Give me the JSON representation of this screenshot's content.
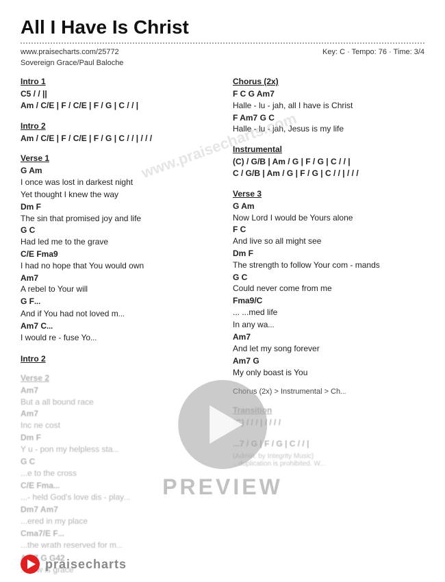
{
  "title": "All I Have Is Christ",
  "meta": {
    "url": "www.praisecharts.com/25772",
    "key_tempo_time": "Key: C · Tempo: 76 · Time: 3/4",
    "author": "Sovereign Grace/Paul Baloche"
  },
  "sections": {
    "left": [
      {
        "id": "intro1",
        "title": "Intro 1",
        "lines": [
          {
            "type": "chord",
            "text": "C5  /  /  ||"
          },
          {
            "type": "chord",
            "text": "Am  /  C/E  |  F  /  C/E  |  F  /  G  |  C  /  /  |"
          }
        ]
      },
      {
        "id": "intro2",
        "title": "Intro 2",
        "lines": [
          {
            "type": "chord",
            "text": "Am  /  C/E  |  F  /  C/E  |  F  /  G  |  C  /  /  |  /  /  /"
          }
        ]
      },
      {
        "id": "verse1",
        "title": "Verse 1",
        "lines": [
          {
            "type": "chord",
            "text": "             G             Am"
          },
          {
            "type": "lyric",
            "text": "I once was lost in darkest night"
          },
          {
            "type": "lyric",
            "text": "Yet thought I knew the way"
          },
          {
            "type": "chord",
            "text": "         Dm                       F"
          },
          {
            "type": "lyric",
            "text": "The sin that promised joy and life"
          },
          {
            "type": "chord",
            "text": "             G          C"
          },
          {
            "type": "lyric",
            "text": "Had led me to the grave"
          },
          {
            "type": "chord",
            "text": "      C/E                  Fma9"
          },
          {
            "type": "lyric",
            "text": "I had no hope that You would own"
          },
          {
            "type": "chord",
            "text": "              Am7"
          },
          {
            "type": "lyric",
            "text": "A rebel to Your will"
          },
          {
            "type": "chord",
            "text": "          G                     F..."
          },
          {
            "type": "lyric",
            "text": "And if You had not loved m..."
          },
          {
            "type": "chord",
            "text": "       Am7          C..."
          },
          {
            "type": "lyric",
            "text": "I would re - fuse Yo..."
          }
        ]
      },
      {
        "id": "intro2b",
        "title": "Intro 2",
        "lines": []
      },
      {
        "id": "verse2",
        "title": "Verse 2",
        "lines": [
          {
            "type": "chord",
            "text": "                        Am7"
          },
          {
            "type": "lyric",
            "text": "But a           all bound race"
          },
          {
            "type": "chord",
            "text": "                  Am7"
          },
          {
            "type": "lyric",
            "text": "Inc           ne cost"
          },
          {
            "type": "chord",
            "text": "              Dm             F"
          },
          {
            "type": "lyric",
            "text": "Y     u - pon my helpless sta..."
          },
          {
            "type": "chord",
            "text": "     G       C"
          },
          {
            "type": "lyric",
            "text": "...e to the cross"
          },
          {
            "type": "chord",
            "text": "      C/E                     Fma..."
          },
          {
            "type": "lyric",
            "text": "...- held God's love dis - play..."
          },
          {
            "type": "chord",
            "text": "         Dm7      Am7"
          },
          {
            "type": "lyric",
            "text": "...ered in  my place"
          },
          {
            "type": "chord",
            "text": "         Cma7/E              F..."
          },
          {
            "type": "lyric",
            "text": "...the wrath reserved for m..."
          },
          {
            "type": "chord",
            "text": "    Am7     G      G42"
          },
          {
            "type": "lyric",
            "text": "...now is grace"
          }
        ]
      }
    ],
    "right": [
      {
        "id": "chorus",
        "title": "Chorus (2x)",
        "lines": [
          {
            "type": "chord",
            "text": "          F    C         G      Am7"
          },
          {
            "type": "lyric",
            "text": "Halle - lu - jah, all I have is Christ"
          },
          {
            "type": "chord",
            "text": "             F      Am7        G          C"
          },
          {
            "type": "lyric",
            "text": "Halle - lu - jah, Jesus is my life"
          }
        ]
      },
      {
        "id": "instrumental",
        "title": "Instrumental",
        "lines": [
          {
            "type": "chord",
            "text": "(C)  /  G/B  |  Am  /  G  |  F  /  G  |  C  /  /  |"
          },
          {
            "type": "chord",
            "text": "C  /  G/B  |  Am  /  G  |  F  /  G  |  C  /  /  |  /  /  /"
          }
        ]
      },
      {
        "id": "verse3",
        "title": "Verse 3",
        "lines": [
          {
            "type": "chord",
            "text": "                G                 Am"
          },
          {
            "type": "lyric",
            "text": "Now Lord I would be Yours alone"
          },
          {
            "type": "chord",
            "text": "                   F              C"
          },
          {
            "type": "lyric",
            "text": "And live so all might see"
          },
          {
            "type": "chord",
            "text": "               Dm                        F"
          },
          {
            "type": "lyric",
            "text": "The strength to follow Your com - mands"
          },
          {
            "type": "chord",
            "text": "             G           C"
          },
          {
            "type": "lyric",
            "text": "Could never come from me"
          },
          {
            "type": "chord",
            "text": "                                   Fma9/C"
          },
          {
            "type": "lyric",
            "text": "...                          ...med  life"
          },
          {
            "type": "lyric",
            "text": "In any wa..."
          },
          {
            "type": "chord",
            "text": "          Am7"
          },
          {
            "type": "lyric",
            "text": "And let my song forever"
          },
          {
            "type": "chord",
            "text": "                Am7         G"
          },
          {
            "type": "lyric",
            "text": "My only boast is You"
          }
        ]
      },
      {
        "id": "chorus_transition",
        "title": "Chorus (2x) > Instrumental > Ch...",
        "lines": []
      },
      {
        "id": "transition",
        "title": "Transition",
        "lines": [
          {
            "type": "chord",
            "text": "(C)  /  /  /  |  /  /  /  /"
          }
        ]
      },
      {
        "id": "transition2",
        "title": "",
        "lines": [
          {
            "type": "chord",
            "text": "...7  /  G  |  F  /  G  |  C  /  /  |"
          },
          {
            "type": "small",
            "text": "(Admin. by Integrity Music)"
          },
          {
            "type": "small",
            "text": "...duplication is prohibited. W..."
          }
        ]
      }
    ]
  },
  "watermark": "www.praisecharts.com",
  "preview_label": "PREVIEW",
  "footer": {
    "brand": "praisecharts"
  }
}
